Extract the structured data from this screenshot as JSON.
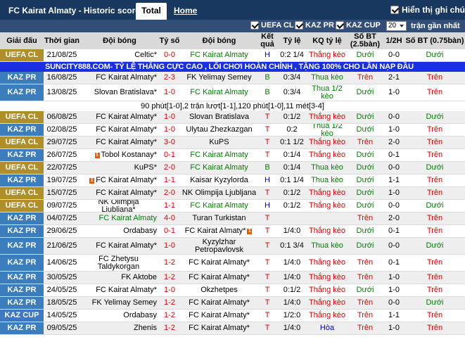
{
  "header": {
    "title": "FC Kairat Almaty - Historic scores",
    "tab_total": "Total",
    "tab_home": "Home",
    "show_notes": "Hiển thị ghi chú"
  },
  "filters": {
    "uefa_cl": "UEFA CL",
    "kaz_pr": "KAZ PR",
    "kaz_cup": "KAZ CUP",
    "recent_count": "20",
    "recent_label": "trận gần nhất"
  },
  "columns": {
    "league": "Giải đấu",
    "time": "Thời gian",
    "home": "Đội bóng",
    "score": "Tỷ số",
    "away": "Đội bóng",
    "result": "Kết quả",
    "odds": "Tỷ lệ",
    "odds_result": "KQ tỷ lệ",
    "ou_2_5": "Số BT (2.5bàn)",
    "half": "1/2H",
    "ou_0_75": "Số BT (0.75bàn)"
  },
  "banner": "SUNCITY888.COM- TỶ LỆ THẮNG CỰC CAO , LỐI CHƠI HOÀN CHỈNH , TẶNG 100% CHO LẦN NẠP ĐẦU",
  "note_row": "90 phút[1-0],2 trận lượt[1-1],120 phút[1-0],11 mét[3-4]",
  "matches": [
    {
      "league": "UEFA CL",
      "date": "21/08/25",
      "home": "Celtic*",
      "score": "0-0",
      "away": "FC Kairat Almaty",
      "res": "H",
      "odds": "0:2 1/4",
      "kq": "Thắng kèo",
      "ou": "Dưới",
      "half": "0-0",
      "ou2": "Dưới"
    },
    {
      "league": "KAZ PR",
      "date": "16/08/25",
      "home": "FC Kairat Almaty*",
      "score": "2-3",
      "away": "FK Yelimay Semey",
      "res": "B",
      "odds": "0:3/4",
      "kq": "Thua kèo",
      "ou": "Trên",
      "half": "2-1",
      "ou2": "Trên"
    },
    {
      "league": "KAZ PR",
      "date": "13/08/25",
      "home": "Slovan Bratislava*",
      "score": "1-0",
      "away": "FC Kairat Almaty",
      "res": "B",
      "odds": "0:3/4",
      "kq": "Thua 1/2 kèo",
      "ou": "Dưới",
      "half": "1-0",
      "ou2": "Trên"
    },
    {
      "league": "UEFA CL",
      "date": "06/08/25",
      "home": "FC Kairat Almaty*",
      "score": "1-0",
      "away": "Slovan Bratislava",
      "res": "T",
      "odds": "0:1/2",
      "kq": "Thắng kèo",
      "ou": "Dưới",
      "half": "0-0",
      "ou2": "Dưới"
    },
    {
      "league": "KAZ PR",
      "date": "02/08/25",
      "home": "FC Kairat Almaty*",
      "score": "1-0",
      "away": "Ulytau Zhezkazgan",
      "res": "T",
      "odds": "0:2",
      "kq": "Thua 1/2 kèo",
      "ou": "Dưới",
      "half": "1-0",
      "ou2": "Trên"
    },
    {
      "league": "UEFA CL",
      "date": "29/07/25",
      "home": "FC Kairat Almaty*",
      "score": "3-0",
      "away": "KuPS",
      "res": "T",
      "odds": "0:1 1/2",
      "kq": "Thắng kèo",
      "ou": "Trên",
      "half": "2-0",
      "ou2": "Trên"
    },
    {
      "league": "KAZ PR",
      "date": "26/07/25",
      "home": "Tobol Kostanay*",
      "score": "0-1",
      "away": "FC Kairat Almaty",
      "res": "T",
      "odds": "0:1/4",
      "kq": "Thắng kèo",
      "ou": "Dưới",
      "half": "0-1",
      "ou2": "Trên"
    },
    {
      "league": "UEFA CL",
      "date": "22/07/25",
      "home": "KuPS*",
      "score": "2-0",
      "away": "FC Kairat Almaty",
      "res": "B",
      "odds": "0:1/4",
      "kq": "Thua kèo",
      "ou": "Dưới",
      "half": "0-0",
      "ou2": "Dưới"
    },
    {
      "league": "KAZ PR",
      "date": "19/07/25",
      "home": "FC Kairat Almaty*",
      "score": "1-1",
      "away": "Kaisar Kyzylorda",
      "res": "H",
      "odds": "0:1 1/4",
      "kq": "Thua kèo",
      "ou": "Dưới",
      "half": "1-1",
      "ou2": "Trên"
    },
    {
      "league": "UEFA CL",
      "date": "15/07/25",
      "home": "FC Kairat Almaty*",
      "score": "2-0",
      "away": "NK Olimpija Ljubljana",
      "res": "T",
      "odds": "0:1/2",
      "kq": "Thắng kèo",
      "ou": "Dưới",
      "half": "1-0",
      "ou2": "Trên"
    },
    {
      "league": "UEFA CL",
      "date": "09/07/25",
      "home": "NK Olimpija Ljubljana*",
      "score": "1-1",
      "away": "FC Kairat Almaty",
      "res": "H",
      "odds": "0:1/2",
      "kq": "Thắng kèo",
      "ou": "Dưới",
      "half": "0-0",
      "ou2": "Dưới"
    },
    {
      "league": "KAZ PR",
      "date": "04/07/25",
      "home": "FC Kairat Almaty",
      "score": "4-0",
      "away": "Turan Turkistan",
      "res": "T",
      "odds": "",
      "kq": "",
      "ou": "Trên",
      "half": "2-0",
      "ou2": "Trên"
    },
    {
      "league": "KAZ PR",
      "date": "29/06/25",
      "home": "Ordabasy",
      "score": "0-1",
      "away": "FC Kairat Almaty*",
      "res": "T",
      "odds": "1/4:0",
      "kq": "Thắng kèo",
      "ou": "Dưới",
      "half": "0-1",
      "ou2": "Trên"
    },
    {
      "league": "KAZ PR",
      "date": "21/06/25",
      "home": "FC Kairat Almaty*",
      "score": "1-0",
      "away": "Kyzylzhar Petropavlovsk",
      "res": "T",
      "odds": "0:1 3/4",
      "kq": "Thua kèo",
      "ou": "Dưới",
      "half": "0-0",
      "ou2": "Dưới"
    },
    {
      "league": "KAZ PR",
      "date": "14/06/25",
      "home": "FC Zhetysu Taldykorgan",
      "score": "1-2",
      "away": "FC Kairat Almaty*",
      "res": "T",
      "odds": "1/4:0",
      "kq": "Thắng kèo",
      "ou": "Trên",
      "half": "0-1",
      "ou2": "Trên"
    },
    {
      "league": "KAZ PR",
      "date": "30/05/25",
      "home": "FK Aktobe",
      "score": "1-2",
      "away": "FC Kairat Almaty*",
      "res": "T",
      "odds": "1/4:0",
      "kq": "Thắng kèo",
      "ou": "Trên",
      "half": "1-0",
      "ou2": "Trên"
    },
    {
      "league": "KAZ PR",
      "date": "24/05/25",
      "home": "FC Kairat Almaty*",
      "score": "1-0",
      "away": "Okzhetpes",
      "res": "T",
      "odds": "0:1/2",
      "kq": "Thắng kèo",
      "ou": "Dưới",
      "half": "1-0",
      "ou2": "Trên"
    },
    {
      "league": "KAZ PR",
      "date": "18/05/25",
      "home": "FK Yelimay Semey",
      "score": "1-2",
      "away": "FC Kairat Almaty*",
      "res": "T",
      "odds": "1/4:0",
      "kq": "Thắng kèo",
      "ou": "Trên",
      "half": "0-0",
      "ou2": "Dưới"
    },
    {
      "league": "KAZ CUP",
      "date": "14/05/25",
      "home": "Ordabasy",
      "score": "1-2",
      "away": "FC Kairat Almaty*",
      "res": "T",
      "odds": "1/2:0",
      "kq": "Thắng kèo",
      "ou": "Trên",
      "half": "1-1",
      "ou2": "Trên"
    },
    {
      "league": "KAZ PR",
      "date": "09/05/25",
      "home": "Zhenis",
      "score": "1-2",
      "away": "FC Kairat Almaty*",
      "res": "T",
      "odds": "1/4:0",
      "kq": "Hòa",
      "ou": "Trên",
      "half": "1-0",
      "ou2": "Trên"
    }
  ]
}
